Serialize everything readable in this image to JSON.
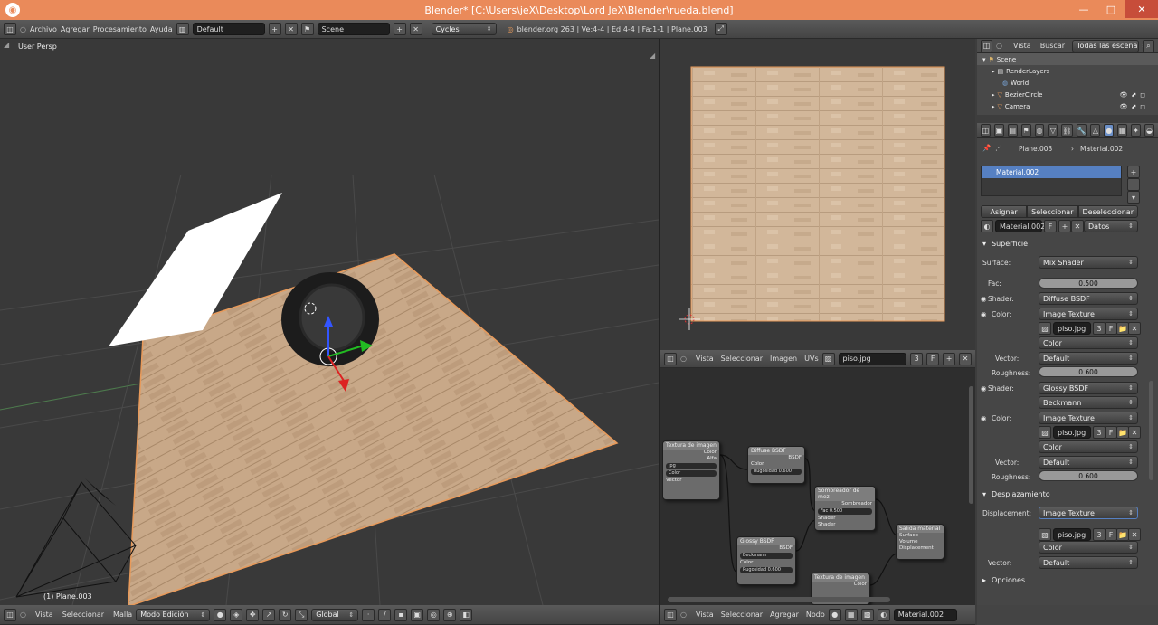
{
  "window": {
    "title": "Blender* [C:\\Users\\jeX\\Desktop\\Lord JeX\\Blender\\rueda.blend]"
  },
  "topbar": {
    "menus": [
      "Archivo",
      "Agregar",
      "Procesamiento",
      "Ayuda"
    ],
    "layout": "Default",
    "scene": "Scene",
    "engine": "Cycles",
    "stats": "blender.org 263 | Ve:4-4 | Ed:4-4 | Fa:1-1 | Plane.003"
  },
  "viewport": {
    "label": "User Persp",
    "object": "(1) Plane.003",
    "menus": [
      "Vista",
      "Seleccionar",
      "Malla"
    ],
    "mode": "Modo Edición",
    "orientation": "Global"
  },
  "image_editor": {
    "menus": [
      "Vista",
      "Seleccionar",
      "Imagen",
      "UVs"
    ],
    "image_name": "piso.jpg",
    "users": "3",
    "fake": "F"
  },
  "node_editor": {
    "menus": [
      "Vista",
      "Seleccionar",
      "Agregar",
      "Nodo"
    ],
    "material": "Material.002"
  },
  "nodes": {
    "tex1": {
      "title": "Textura de imagen",
      "out1": "Color",
      "out2": "Alfa",
      "img": "jpg",
      "sel": "Color",
      "in": "Vector"
    },
    "diffuse": {
      "title": "Diffuse BSDF",
      "out": "BSDF",
      "in1": "Color",
      "rough": "Rugosidad 0.600"
    },
    "glossy": {
      "title": "Glossy BSDF",
      "out": "BSDF",
      "dist": "Beckmann",
      "in1": "Color",
      "rough": "Rugosidad 0.600"
    },
    "mix": {
      "title": "Sombreador de mez",
      "out": "Sombreador",
      "fac": "Fac 0.500",
      "in1": "Shader",
      "in2": "Shader"
    },
    "output": {
      "title": "Salida material",
      "in1": "Surface",
      "in2": "Volume",
      "in3": "Displacement"
    },
    "tex2": {
      "title": "Textura de imagen",
      "out1": "Color"
    }
  },
  "outliner": {
    "menus": [
      "Vista",
      "Buscar"
    ],
    "filter": "Todas las escena",
    "items": [
      "Scene",
      "RenderLayers",
      "World",
      "BezierCircle",
      "Camera"
    ]
  },
  "properties": {
    "breadcrumb": [
      "Plane.003",
      "Material.002"
    ],
    "slot": "Material.002",
    "buttons": [
      "Asignar",
      "Seleccionar",
      "Deseleccionar"
    ],
    "material_name": "Material.002",
    "material_fake": "F",
    "link": "Datos",
    "surface_panel": "Superficie",
    "surface_label": "Surface:",
    "surface_value": "Mix Shader",
    "fac_label": "Fac:",
    "fac_value": "0.500",
    "shader1_label": "Shader:",
    "shader1_value": "Diffuse BSDF",
    "color1_label": "Color:",
    "color1_value": "Image Texture",
    "img1": "piso.jpg",
    "img1_users": "3",
    "img1_fake": "F",
    "img1_color": "Color",
    "vector1_label": "Vector:",
    "vector1_value": "Default",
    "rough1_label": "Roughness:",
    "rough1_value": "0.600",
    "shader2_label": "Shader:",
    "shader2_value": "Glossy BSDF",
    "shader2_dist": "Beckmann",
    "color2_label": "Color:",
    "color2_value": "Image Texture",
    "img2": "piso.jpg",
    "img2_users": "3",
    "img2_fake": "F",
    "img2_color": "Color",
    "vector2_label": "Vector:",
    "vector2_value": "Default",
    "rough2_label": "Roughness:",
    "rough2_value": "0.600",
    "disp_panel": "Desplazamiento",
    "disp_label": "Displacement:",
    "disp_value": "Image Texture",
    "img3": "piso.jpg",
    "img3_users": "3",
    "img3_fake": "F",
    "img3_color": "Color",
    "vector3_label": "Vector:",
    "vector3_value": "Default",
    "options_panel": "Opciones"
  },
  "colors": {
    "titlebar": "#ea8a5a",
    "selection": "#5680c2",
    "wood": "#c9a88a"
  }
}
